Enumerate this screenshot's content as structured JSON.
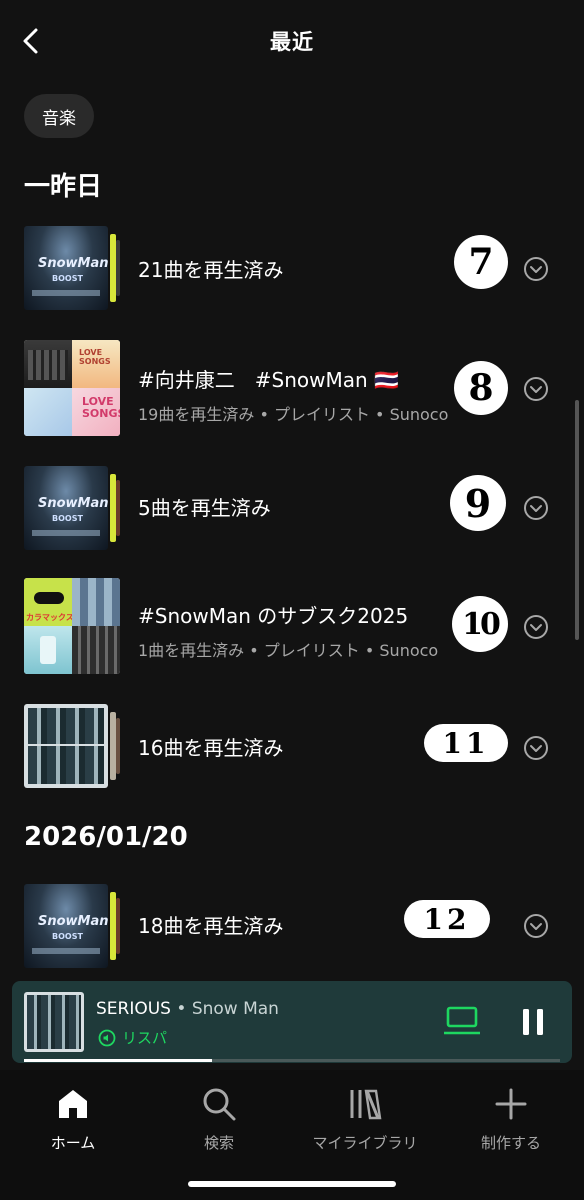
{
  "header": {
    "title": "最近",
    "back_icon": "chevron-left-icon"
  },
  "filter_chip": {
    "label": "音楽"
  },
  "sections": [
    {
      "title": "一昨日"
    },
    {
      "title": "2026/01/20"
    }
  ],
  "rows": [
    {
      "title": "21曲を再生済み",
      "subtitle": "",
      "mark": "7",
      "cover": "snowman-boost"
    },
    {
      "title": "#向井康二　#SnowMan 🇹🇭",
      "subtitle": "19曲を再生済み • プレイリスト • Sunoco",
      "mark": "8",
      "cover": "love-songs"
    },
    {
      "title": "5曲を再生済み",
      "subtitle": "",
      "mark": "9",
      "cover": "snowman-boost"
    },
    {
      "title": "#SnowMan のサブスク2025",
      "subtitle": "1曲を再生済み • プレイリスト • Sunoco",
      "mark": "10",
      "cover": "subscription-2025"
    },
    {
      "title": "16曲を再生済み",
      "subtitle": "",
      "mark": "11",
      "cover": "group-grid"
    },
    {
      "title": "18曲を再生済み",
      "subtitle": "",
      "mark": "12",
      "cover": "snowman-boost"
    }
  ],
  "cover_text": {
    "brand": "SnowMan",
    "album": "BOOST"
  },
  "now_playing": {
    "track": "SERIOUS",
    "separator": " • ",
    "artist": "Snow Man",
    "device": "リスパ",
    "progress": 0.35,
    "device_icon": "laptop-icon",
    "control_icon": "pause-icon"
  },
  "nav": [
    {
      "label": "ホーム",
      "icon": "home-icon",
      "active": true
    },
    {
      "label": "検索",
      "icon": "search-icon",
      "active": false
    },
    {
      "label": "マイライブラリ",
      "icon": "library-icon",
      "active": false
    },
    {
      "label": "制作する",
      "icon": "plus-icon",
      "active": false
    }
  ],
  "colors": {
    "background": "#121212",
    "accent": "#1ed760",
    "miniplayer": "#1f3a3a"
  }
}
